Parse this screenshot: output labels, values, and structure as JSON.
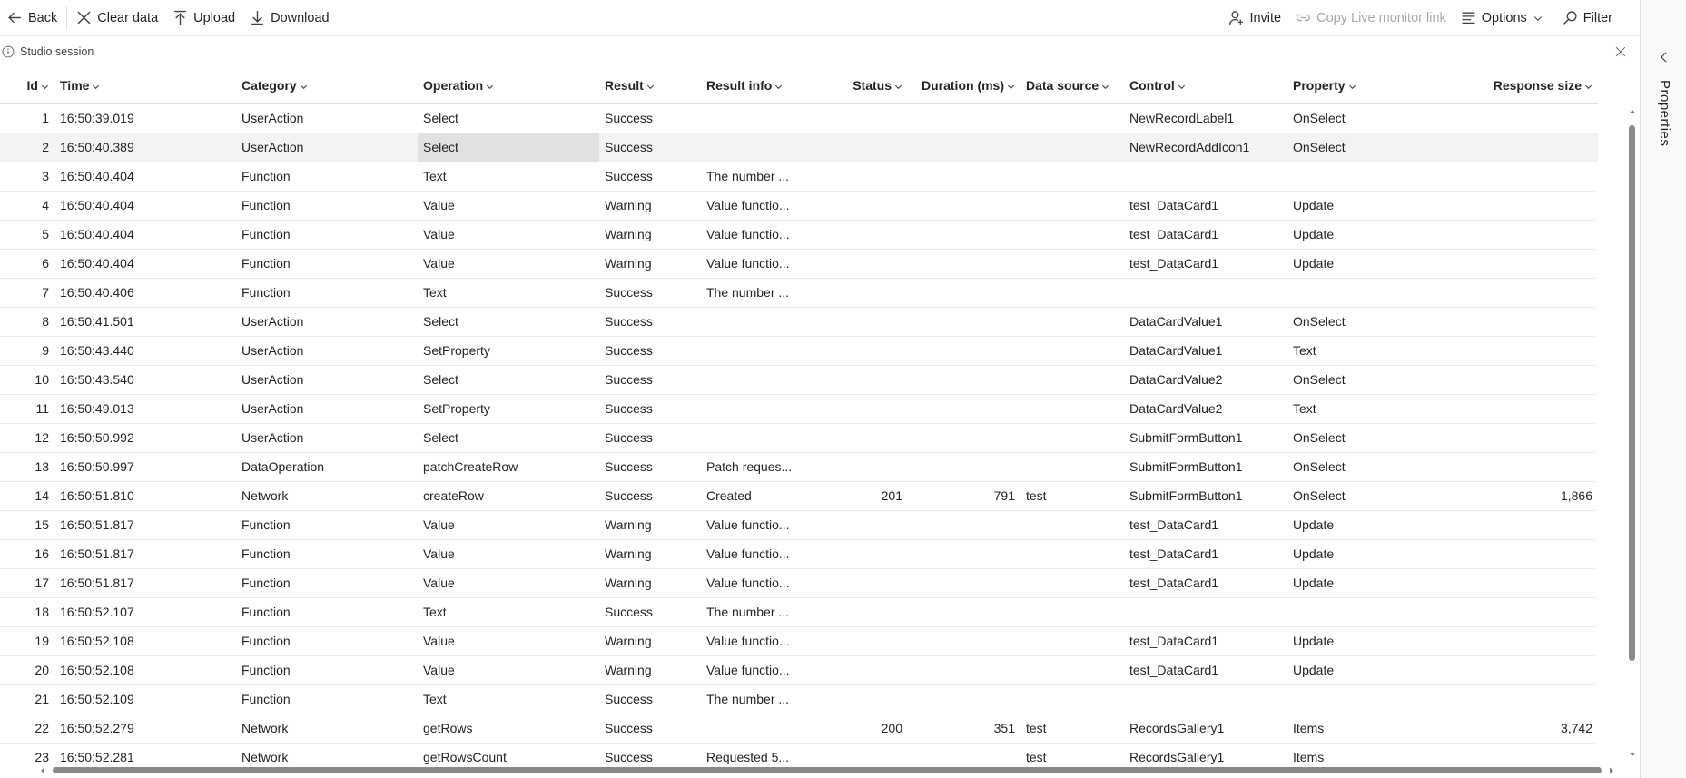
{
  "toolbar": {
    "back": "Back",
    "clear_data": "Clear data",
    "upload": "Upload",
    "download": "Download",
    "invite": "Invite",
    "copy_link": "Copy Live monitor link",
    "options": "Options",
    "filter": "Filter"
  },
  "session": {
    "label": "Studio session"
  },
  "side_panel": {
    "label": "Properties"
  },
  "columns": [
    "Id",
    "Time",
    "Category",
    "Operation",
    "Result",
    "Result info",
    "Status",
    "Duration (ms)",
    "Data source",
    "Control",
    "Property",
    "Response size"
  ],
  "rows": [
    [
      "1",
      "16:50:39.019",
      "UserAction",
      "Select",
      "Success",
      "",
      "",
      "",
      "",
      "NewRecordLabel1",
      "OnSelect",
      ""
    ],
    [
      "2",
      "16:50:40.389",
      "UserAction",
      "Select",
      "Success",
      "",
      "",
      "",
      "",
      "NewRecordAddIcon1",
      "OnSelect",
      ""
    ],
    [
      "3",
      "16:50:40.404",
      "Function",
      "Text",
      "Success",
      "The number ...",
      "",
      "",
      "",
      "",
      "",
      ""
    ],
    [
      "4",
      "16:50:40.404",
      "Function",
      "Value",
      "Warning",
      "Value functio...",
      "",
      "",
      "",
      "test_DataCard1",
      "Update",
      ""
    ],
    [
      "5",
      "16:50:40.404",
      "Function",
      "Value",
      "Warning",
      "Value functio...",
      "",
      "",
      "",
      "test_DataCard1",
      "Update",
      ""
    ],
    [
      "6",
      "16:50:40.404",
      "Function",
      "Value",
      "Warning",
      "Value functio...",
      "",
      "",
      "",
      "test_DataCard1",
      "Update",
      ""
    ],
    [
      "7",
      "16:50:40.406",
      "Function",
      "Text",
      "Success",
      "The number ...",
      "",
      "",
      "",
      "",
      "",
      ""
    ],
    [
      "8",
      "16:50:41.501",
      "UserAction",
      "Select",
      "Success",
      "",
      "",
      "",
      "",
      "DataCardValue1",
      "OnSelect",
      ""
    ],
    [
      "9",
      "16:50:43.440",
      "UserAction",
      "SetProperty",
      "Success",
      "",
      "",
      "",
      "",
      "DataCardValue1",
      "Text",
      ""
    ],
    [
      "10",
      "16:50:43.540",
      "UserAction",
      "Select",
      "Success",
      "",
      "",
      "",
      "",
      "DataCardValue2",
      "OnSelect",
      ""
    ],
    [
      "11",
      "16:50:49.013",
      "UserAction",
      "SetProperty",
      "Success",
      "",
      "",
      "",
      "",
      "DataCardValue2",
      "Text",
      ""
    ],
    [
      "12",
      "16:50:50.992",
      "UserAction",
      "Select",
      "Success",
      "",
      "",
      "",
      "",
      "SubmitFormButton1",
      "OnSelect",
      ""
    ],
    [
      "13",
      "16:50:50.997",
      "DataOperation",
      "patchCreateRow",
      "Success",
      "Patch reques...",
      "",
      "",
      "",
      "SubmitFormButton1",
      "OnSelect",
      ""
    ],
    [
      "14",
      "16:50:51.810",
      "Network",
      "createRow",
      "Success",
      "Created",
      "201",
      "791",
      "test",
      "SubmitFormButton1",
      "OnSelect",
      "1,866"
    ],
    [
      "15",
      "16:50:51.817",
      "Function",
      "Value",
      "Warning",
      "Value functio...",
      "",
      "",
      "",
      "test_DataCard1",
      "Update",
      ""
    ],
    [
      "16",
      "16:50:51.817",
      "Function",
      "Value",
      "Warning",
      "Value functio...",
      "",
      "",
      "",
      "test_DataCard1",
      "Update",
      ""
    ],
    [
      "17",
      "16:50:51.817",
      "Function",
      "Value",
      "Warning",
      "Value functio...",
      "",
      "",
      "",
      "test_DataCard1",
      "Update",
      ""
    ],
    [
      "18",
      "16:50:52.107",
      "Function",
      "Text",
      "Success",
      "The number ...",
      "",
      "",
      "",
      "",
      "",
      ""
    ],
    [
      "19",
      "16:50:52.108",
      "Function",
      "Value",
      "Warning",
      "Value functio...",
      "",
      "",
      "",
      "test_DataCard1",
      "Update",
      ""
    ],
    [
      "20",
      "16:50:52.108",
      "Function",
      "Value",
      "Warning",
      "Value functio...",
      "",
      "",
      "",
      "test_DataCard1",
      "Update",
      ""
    ],
    [
      "21",
      "16:50:52.109",
      "Function",
      "Text",
      "Success",
      "The number ...",
      "",
      "",
      "",
      "",
      "",
      ""
    ],
    [
      "22",
      "16:50:52.279",
      "Network",
      "getRows",
      "Success",
      "",
      "200",
      "351",
      "test",
      "RecordsGallery1",
      "Items",
      "3,742"
    ],
    [
      "23",
      "16:50:52.281",
      "Network",
      "getRowsCount",
      "Success",
      "Requested 5...",
      "",
      "",
      "test",
      "RecordsGallery1",
      "Items",
      ""
    ]
  ],
  "selected_row": 1
}
